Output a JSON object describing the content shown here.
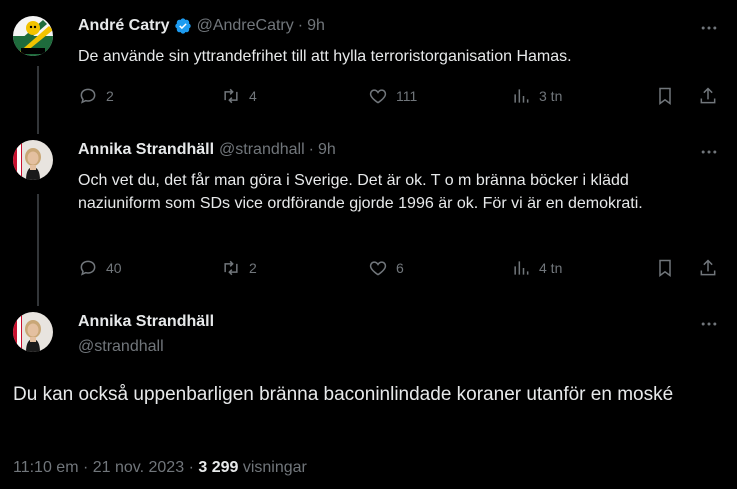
{
  "tweet1": {
    "name": "André Catry",
    "handle": "@AndreCatry",
    "separator": "·",
    "time": "9h",
    "text": "De använde sin yttrandefrihet till att hylla terroristorganisation Hamas.",
    "replies": "2",
    "retweets": "4",
    "likes": "111",
    "views": "3 tn"
  },
  "tweet2": {
    "name": "Annika Strandhäll",
    "handle": "@strandhall",
    "separator": "·",
    "time": "9h",
    "text": "Och vet du, det får man göra i Sverige. Det är ok. T o m bränna böcker i klädd naziuniform som SDs vice ordförande gjorde 1996 är ok. För vi är en demokrati.",
    "replies": "40",
    "retweets": "2",
    "likes": "6",
    "views": "4 tn"
  },
  "main_tweet": {
    "name": "Annika Strandhäll",
    "handle": "@strandhall",
    "text": "Du kan också uppenbarligen bränna baconinlindade koraner utanför en moské",
    "time": "11:10 em",
    "separator": "·",
    "date": "21 nov. 2023",
    "separator2": "·",
    "views_count": "3 299",
    "views_label": "visningar"
  },
  "colors": {
    "background": "#000000",
    "text": "#e7e9ea",
    "secondary": "#71767b",
    "verified": "#1d9bf0",
    "line": "#333639"
  }
}
